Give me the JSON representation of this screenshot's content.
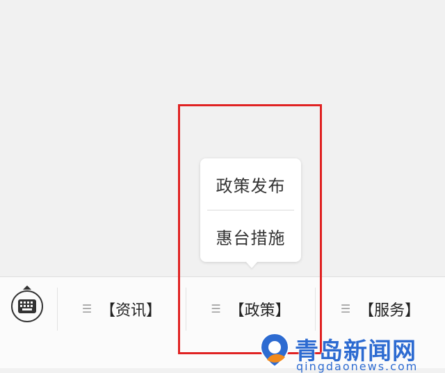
{
  "popup": {
    "items": [
      {
        "label": "政策发布"
      },
      {
        "label": "惠台措施"
      }
    ]
  },
  "menu_bar": {
    "keyboard_icon": "keyboard-icon",
    "tabs": [
      {
        "label": "【资讯】",
        "icon": "menu-lines-icon"
      },
      {
        "label": "【政策】",
        "icon": "menu-lines-icon"
      },
      {
        "label": "【服务】",
        "icon": "menu-lines-icon"
      }
    ]
  },
  "watermark": {
    "title": "青岛新闻网",
    "url": "qingdaonews.com"
  },
  "colors": {
    "highlight": "#e02222",
    "watermark": "#2d6bd1",
    "background": "#f1f1f1"
  }
}
